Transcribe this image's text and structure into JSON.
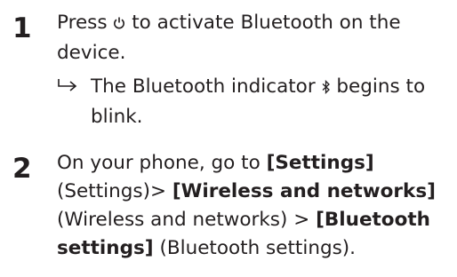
{
  "steps": [
    {
      "number": "1",
      "text_before_icon": "Press ",
      "icon": "power-icon",
      "text_after_icon": " to activate Bluetooth on the device.",
      "result": {
        "arrow_icon": "result-arrow-icon",
        "text_before_icon": "The Bluetooth indicator ",
        "icon": "bluetooth-icon",
        "text_after_icon": " begins to blink."
      }
    },
    {
      "number": "2",
      "intro": "On your phone, go to ",
      "settings_bracket": "[Settings]",
      "settings_plain": "(Settings)> ",
      "wireless_bracket": "[Wireless and networks]",
      "wireless_plain": " (Wireless and networks) > ",
      "bt_bracket": "[Bluetooth settings]",
      "bt_plain": " (Bluetooth settings)."
    }
  ]
}
